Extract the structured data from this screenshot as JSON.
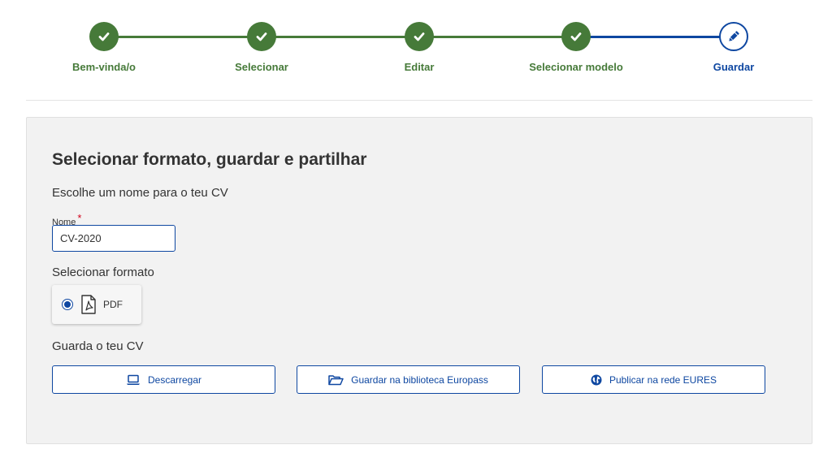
{
  "stepper": {
    "steps": [
      {
        "label": "Bem-vinda/o",
        "state": "done"
      },
      {
        "label": "Selecionar",
        "state": "done"
      },
      {
        "label": "Editar",
        "state": "done"
      },
      {
        "label": "Selecionar modelo",
        "state": "done"
      },
      {
        "label": "Guardar",
        "state": "current"
      }
    ]
  },
  "panel": {
    "title": "Selecionar formato, guardar e partilhar",
    "name_section": "Escolhe um nome para o teu CV",
    "name_label": "Nome",
    "required_marker": "*",
    "name_value": "CV-2020",
    "format_section": "Selecionar formato",
    "format_option": {
      "label": "PDF",
      "selected": true,
      "icon": "pdf-file-icon"
    },
    "save_section": "Guarda o teu CV",
    "buttons": {
      "download": {
        "label": "Descarregar",
        "icon": "laptop-icon"
      },
      "library": {
        "label": "Guardar na biblioteca Europass",
        "icon": "folder-open-icon"
      },
      "eures": {
        "label": "Publicar na rede EURES",
        "icon": "globe-icon"
      }
    }
  },
  "colors": {
    "done_green": "#467a39",
    "current_blue": "#0e47a1",
    "panel_bg": "#f2f2f2"
  }
}
